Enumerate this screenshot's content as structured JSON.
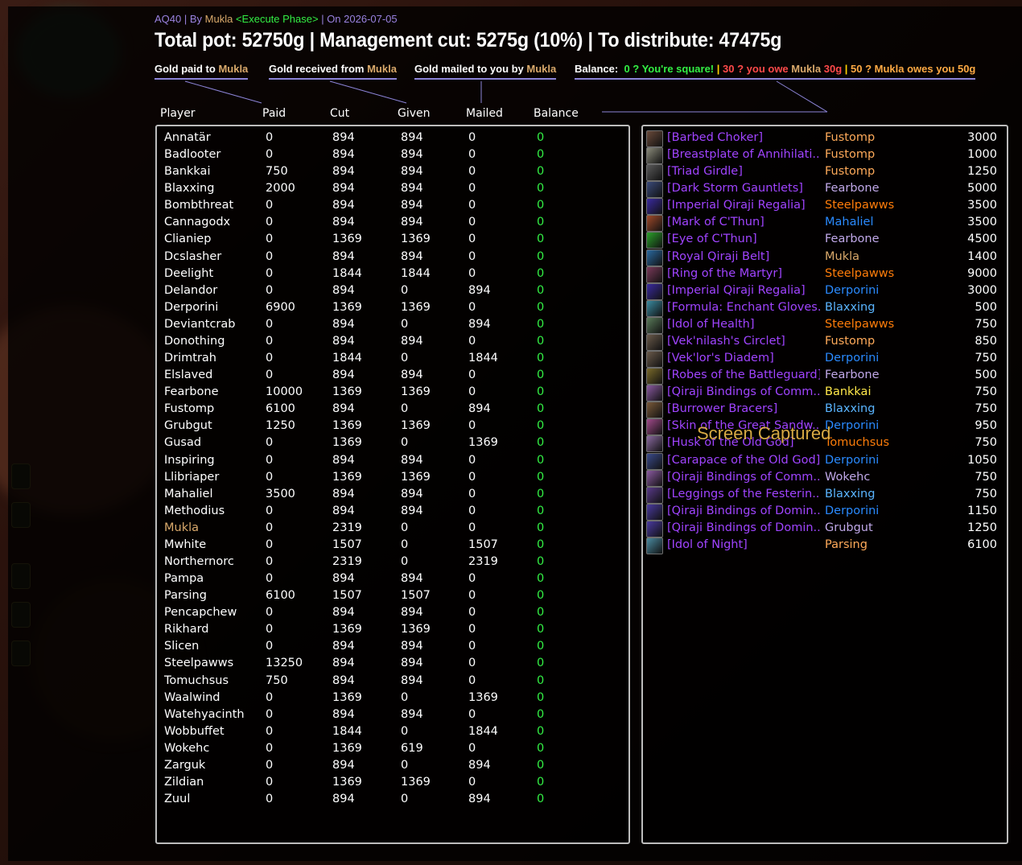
{
  "header": {
    "sub_prefix": "AQ40 | By ",
    "sub_author": "Mukla",
    "sub_phase": "<Execute Phase>",
    "sub_suffix": " | On 2026-07-05",
    "main": "Total pot: 52750g | Management cut: 5275g (10%) | To distribute: 47475g"
  },
  "legend": {
    "paid_label": "Gold paid to ",
    "received_label": "Gold received from ",
    "mailed_label": "Gold mailed to you by ",
    "player": "Mukla",
    "balance_label": "Balance:",
    "square": "0 ? You're square!",
    "sep": "|",
    "owe_prefix": "30 ? you owe ",
    "owe_player": "Mukla",
    "owe_amount": " 30g",
    "owes_text": "50 ? Mukla owes you 50g"
  },
  "columns": {
    "player": "Player",
    "paid": "Paid",
    "cut": "Cut",
    "given": "Given",
    "mailed": "Mailed",
    "balance": "Balance"
  },
  "colors": {
    "guild_leader": "#d9a96b",
    "epic": "#a044ff",
    "balance_ok": "#33ee44"
  },
  "players": [
    {
      "name": "Annatär",
      "paid": "0",
      "cut": "894",
      "given": "894",
      "mailed": "0",
      "balance": "0"
    },
    {
      "name": "Badlooter",
      "paid": "0",
      "cut": "894",
      "given": "894",
      "mailed": "0",
      "balance": "0"
    },
    {
      "name": "Bankkai",
      "paid": "750",
      "cut": "894",
      "given": "894",
      "mailed": "0",
      "balance": "0"
    },
    {
      "name": "Blaxxing",
      "paid": "2000",
      "cut": "894",
      "given": "894",
      "mailed": "0",
      "balance": "0"
    },
    {
      "name": "Bombthreat",
      "paid": "0",
      "cut": "894",
      "given": "894",
      "mailed": "0",
      "balance": "0"
    },
    {
      "name": "Cannagodx",
      "paid": "0",
      "cut": "894",
      "given": "894",
      "mailed": "0",
      "balance": "0"
    },
    {
      "name": "Clianiep",
      "paid": "0",
      "cut": "1369",
      "given": "1369",
      "mailed": "0",
      "balance": "0"
    },
    {
      "name": "Dcslasher",
      "paid": "0",
      "cut": "894",
      "given": "894",
      "mailed": "0",
      "balance": "0"
    },
    {
      "name": "Deelight",
      "paid": "0",
      "cut": "1844",
      "given": "1844",
      "mailed": "0",
      "balance": "0"
    },
    {
      "name": "Delandor",
      "paid": "0",
      "cut": "894",
      "given": "0",
      "mailed": "894",
      "balance": "0"
    },
    {
      "name": "Derporini",
      "paid": "6900",
      "cut": "1369",
      "given": "1369",
      "mailed": "0",
      "balance": "0"
    },
    {
      "name": "Deviantcrab",
      "paid": "0",
      "cut": "894",
      "given": "0",
      "mailed": "894",
      "balance": "0"
    },
    {
      "name": "Donothing",
      "paid": "0",
      "cut": "894",
      "given": "894",
      "mailed": "0",
      "balance": "0"
    },
    {
      "name": "Drimtrah",
      "paid": "0",
      "cut": "1844",
      "given": "0",
      "mailed": "1844",
      "balance": "0"
    },
    {
      "name": "Elslaved",
      "paid": "0",
      "cut": "894",
      "given": "894",
      "mailed": "0",
      "balance": "0"
    },
    {
      "name": "Fearbone",
      "paid": "10000",
      "cut": "1369",
      "given": "1369",
      "mailed": "0",
      "balance": "0"
    },
    {
      "name": "Fustomp",
      "paid": "6100",
      "cut": "894",
      "given": "0",
      "mailed": "894",
      "balance": "0"
    },
    {
      "name": "Grubgut",
      "paid": "1250",
      "cut": "1369",
      "given": "1369",
      "mailed": "0",
      "balance": "0"
    },
    {
      "name": "Gusad",
      "paid": "0",
      "cut": "1369",
      "given": "0",
      "mailed": "1369",
      "balance": "0"
    },
    {
      "name": "Inspiring",
      "paid": "0",
      "cut": "894",
      "given": "894",
      "mailed": "0",
      "balance": "0"
    },
    {
      "name": "Llibriaper",
      "paid": "0",
      "cut": "1369",
      "given": "1369",
      "mailed": "0",
      "balance": "0"
    },
    {
      "name": "Mahaliel",
      "paid": "3500",
      "cut": "894",
      "given": "894",
      "mailed": "0",
      "balance": "0"
    },
    {
      "name": "Methodius",
      "paid": "0",
      "cut": "894",
      "given": "894",
      "mailed": "0",
      "balance": "0"
    },
    {
      "name": "Mukla",
      "paid": "0",
      "cut": "2319",
      "given": "0",
      "mailed": "0",
      "balance": "0",
      "highlight": true
    },
    {
      "name": "Mwhite",
      "paid": "0",
      "cut": "1507",
      "given": "0",
      "mailed": "1507",
      "balance": "0"
    },
    {
      "name": "Northernorc",
      "paid": "0",
      "cut": "2319",
      "given": "0",
      "mailed": "2319",
      "balance": "0"
    },
    {
      "name": "Pampa",
      "paid": "0",
      "cut": "894",
      "given": "894",
      "mailed": "0",
      "balance": "0"
    },
    {
      "name": "Parsing",
      "paid": "6100",
      "cut": "1507",
      "given": "1507",
      "mailed": "0",
      "balance": "0"
    },
    {
      "name": "Pencapchew",
      "paid": "0",
      "cut": "894",
      "given": "894",
      "mailed": "0",
      "balance": "0"
    },
    {
      "name": "Rikhard",
      "paid": "0",
      "cut": "1369",
      "given": "1369",
      "mailed": "0",
      "balance": "0"
    },
    {
      "name": "Slicen",
      "paid": "0",
      "cut": "894",
      "given": "894",
      "mailed": "0",
      "balance": "0"
    },
    {
      "name": "Steelpawws",
      "paid": "13250",
      "cut": "894",
      "given": "894",
      "mailed": "0",
      "balance": "0"
    },
    {
      "name": "Tomuchsus",
      "paid": "750",
      "cut": "894",
      "given": "894",
      "mailed": "0",
      "balance": "0"
    },
    {
      "name": "Waalwind",
      "paid": "0",
      "cut": "1369",
      "given": "0",
      "mailed": "1369",
      "balance": "0"
    },
    {
      "name": "Watehyacinth",
      "paid": "0",
      "cut": "894",
      "given": "894",
      "mailed": "0",
      "balance": "0"
    },
    {
      "name": "Wobbuffet",
      "paid": "0",
      "cut": "1844",
      "given": "0",
      "mailed": "1844",
      "balance": "0"
    },
    {
      "name": "Wokehc",
      "paid": "0",
      "cut": "1369",
      "given": "619",
      "mailed": "0",
      "balance": "0"
    },
    {
      "name": "Zarguk",
      "paid": "0",
      "cut": "894",
      "given": "0",
      "mailed": "894",
      "balance": "0"
    },
    {
      "name": "Zildian",
      "paid": "0",
      "cut": "1369",
      "given": "1369",
      "mailed": "0",
      "balance": "0"
    },
    {
      "name": "Zuul",
      "paid": "0",
      "cut": "894",
      "given": "0",
      "mailed": "894",
      "balance": "0"
    }
  ],
  "items": [
    {
      "name": "[Barbed Choker]",
      "winner": "Fustomp",
      "winner_color": "#ffaa5a",
      "amount": "3000",
      "icon": "necklace-icon",
      "icon_color": "#6a4a3a"
    },
    {
      "name": "[Breastplate of Annihilati...",
      "winner": "Fustomp",
      "winner_color": "#ffaa5a",
      "amount": "1000",
      "icon": "breastplate-icon",
      "icon_color": "#8a8a7a"
    },
    {
      "name": "[Triad Girdle]",
      "winner": "Fustomp",
      "winner_color": "#ffaa5a",
      "amount": "1250",
      "icon": "belt-icon",
      "icon_color": "#5a5a5a"
    },
    {
      "name": "[Dark Storm Gauntlets]",
      "winner": "Fearbone",
      "winner_color": "#c0a8e8",
      "amount": "5000",
      "icon": "gauntlets-icon",
      "icon_color": "#3a4a7a"
    },
    {
      "name": "[Imperial Qiraji Regalia]",
      "winner": "Steelpawws",
      "winner_color": "#ff7d0a",
      "amount": "3500",
      "icon": "regalia-icon",
      "icon_color": "#3a2aa0"
    },
    {
      "name": "[Mark of C'Thun]",
      "winner": "Mahaliel",
      "winner_color": "#2a8aff",
      "amount": "3500",
      "icon": "mark-icon",
      "icon_color": "#a04a2a"
    },
    {
      "name": "[Eye of C'Thun]",
      "winner": "Fearbone",
      "winner_color": "#c0a8e8",
      "amount": "4500",
      "icon": "eye-icon",
      "icon_color": "#2aa02a"
    },
    {
      "name": "[Royal Qiraji Belt]",
      "winner": "Mukla",
      "winner_color": "#d9a96b",
      "amount": "1400",
      "icon": "belt-icon",
      "icon_color": "#2a6aa0"
    },
    {
      "name": "[Ring of the Martyr]",
      "winner": "Steelpawws",
      "winner_color": "#ff7d0a",
      "amount": "9000",
      "icon": "ring-icon",
      "icon_color": "#7a3a5a"
    },
    {
      "name": "[Imperial Qiraji Regalia]",
      "winner": "Derporini",
      "winner_color": "#2a8aff",
      "amount": "3000",
      "icon": "regalia-icon",
      "icon_color": "#3a2aa0"
    },
    {
      "name": "[Formula: Enchant Gloves...",
      "winner": "Blaxxing",
      "winner_color": "#5ab4ff",
      "amount": "500",
      "icon": "scroll-icon",
      "icon_color": "#3a8aa0"
    },
    {
      "name": "[Idol of Health]",
      "winner": "Steelpawws",
      "winner_color": "#ff7d0a",
      "amount": "750",
      "icon": "idol-icon",
      "icon_color": "#5a7a5a"
    },
    {
      "name": "[Vek'nilash's Circlet]",
      "winner": "Fustomp",
      "winner_color": "#ffaa5a",
      "amount": "850",
      "icon": "circlet-icon",
      "icon_color": "#6a5a4a"
    },
    {
      "name": "[Vek'lor's Diadem]",
      "winner": "Derporini",
      "winner_color": "#2a8aff",
      "amount": "750",
      "icon": "diadem-icon",
      "icon_color": "#6a5a4a"
    },
    {
      "name": "[Robes of the Battleguard]",
      "winner": "Fearbone",
      "winner_color": "#c0a8e8",
      "amount": "500",
      "icon": "robe-icon",
      "icon_color": "#7a6a2a"
    },
    {
      "name": "[Qiraji Bindings of Comm...",
      "winner": "Bankkai",
      "winner_color": "#ffe84a",
      "amount": "750",
      "icon": "bindings-icon",
      "icon_color": "#8a5aa0"
    },
    {
      "name": "[Burrower Bracers]",
      "winner": "Blaxxing",
      "winner_color": "#5ab4ff",
      "amount": "750",
      "icon": "bracers-icon",
      "icon_color": "#7a5a3a"
    },
    {
      "name": "[Skin of the Great Sandw...",
      "winner": "Derporini",
      "winner_color": "#2a8aff",
      "amount": "950",
      "icon": "skin-icon",
      "icon_color": "#a04a8a"
    },
    {
      "name": "[Husk of the Old God]",
      "winner": "Tomuchsus",
      "winner_color": "#ff7d0a",
      "amount": "750",
      "icon": "husk-icon",
      "icon_color": "#8a6aa0"
    },
    {
      "name": "[Carapace of the Old God]",
      "winner": "Derporini",
      "winner_color": "#2a8aff",
      "amount": "1050",
      "icon": "carapace-icon",
      "icon_color": "#3a4a8a"
    },
    {
      "name": "[Qiraji Bindings of Comm...",
      "winner": "Wokehc",
      "winner_color": "#c0a8e8",
      "amount": "750",
      "icon": "bindings-icon",
      "icon_color": "#8a5aa0"
    },
    {
      "name": "[Leggings of the Festerin...",
      "winner": "Blaxxing",
      "winner_color": "#5ab4ff",
      "amount": "750",
      "icon": "leggings-icon",
      "icon_color": "#5a3a8a"
    },
    {
      "name": "[Qiraji Bindings of Domin...",
      "winner": "Derporini",
      "winner_color": "#2a8aff",
      "amount": "1150",
      "icon": "bindings-icon",
      "icon_color": "#4a3aa0"
    },
    {
      "name": "[Qiraji Bindings of Domin...",
      "winner": "Grubgut",
      "winner_color": "#c0a8e8",
      "amount": "1250",
      "icon": "bindings-icon",
      "icon_color": "#4a3aa0"
    },
    {
      "name": "[Idol of Night]",
      "winner": "Parsing",
      "winner_color": "#ffaa5a",
      "amount": "6100",
      "icon": "idol-icon",
      "icon_color": "#4a8aa0"
    }
  ],
  "watermark": "Screen Captured"
}
